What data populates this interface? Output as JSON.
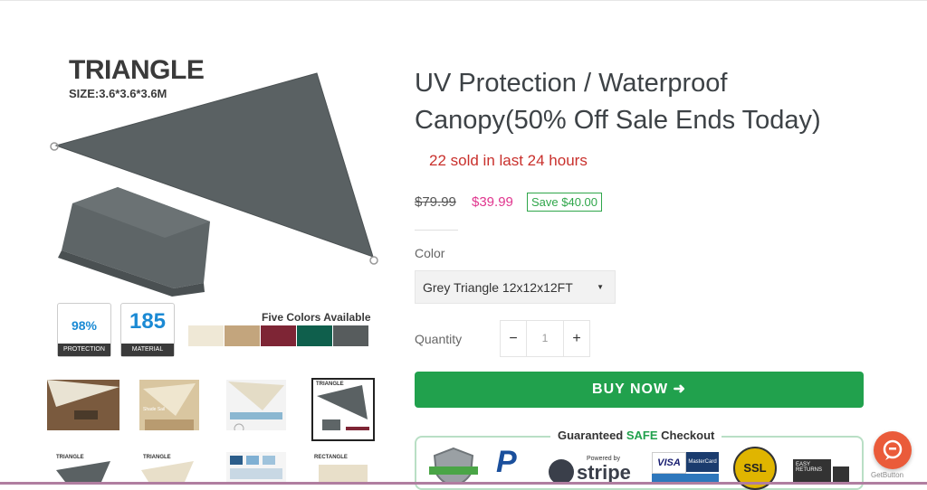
{
  "product": {
    "title": "UV Protection / Waterproof Canopy(50% Off Sale Ends Today)",
    "sold_text": "22 sold in last 24 hours",
    "price_old": "$79.99",
    "price_new": "$39.99",
    "save_text": "Save $40.00",
    "color_label": "Color",
    "color_selected": "Grey Triangle 12x12x12FT",
    "quantity_label": "Quantity",
    "quantity_value": "1",
    "qty_minus": "−",
    "qty_plus": "+",
    "buy_label": "BUY NOW ➜"
  },
  "main_image": {
    "heading": "TRIANGLE",
    "size": "SIZE:3.6*3.6*3.6M",
    "badge1_num": "98%",
    "badge1_label": "PROTECTION",
    "badge2_num": "185",
    "badge2_label": "MATERIAL",
    "five_colors": "Five Colors Available",
    "swatches": [
      "#efe8d6",
      "#c3a57d",
      "#7e2535",
      "#0f5f4c",
      "#575c5d"
    ],
    "shade_color": "#5a6163"
  },
  "checkout": {
    "title_pre": "Guaranteed ",
    "title_safe": "SAFE",
    "title_post": " Checkout",
    "paypal": "P",
    "stripe_powered": "Powered by",
    "stripe": "stripe",
    "visa": "VISA",
    "mastercard": "MasterCard",
    "ssl": "SSL",
    "easy_returns": "EASY RETURNS"
  },
  "widget": {
    "label": "GetButton"
  },
  "thumbnails": {
    "thumb4_title": "TRIANGLE",
    "thumb5_title": "TRIANGLE",
    "thumb6_title": "TRIANGLE",
    "thumb8_title": "RECTANGLE",
    "thumb2_text": "Shade Sail"
  }
}
